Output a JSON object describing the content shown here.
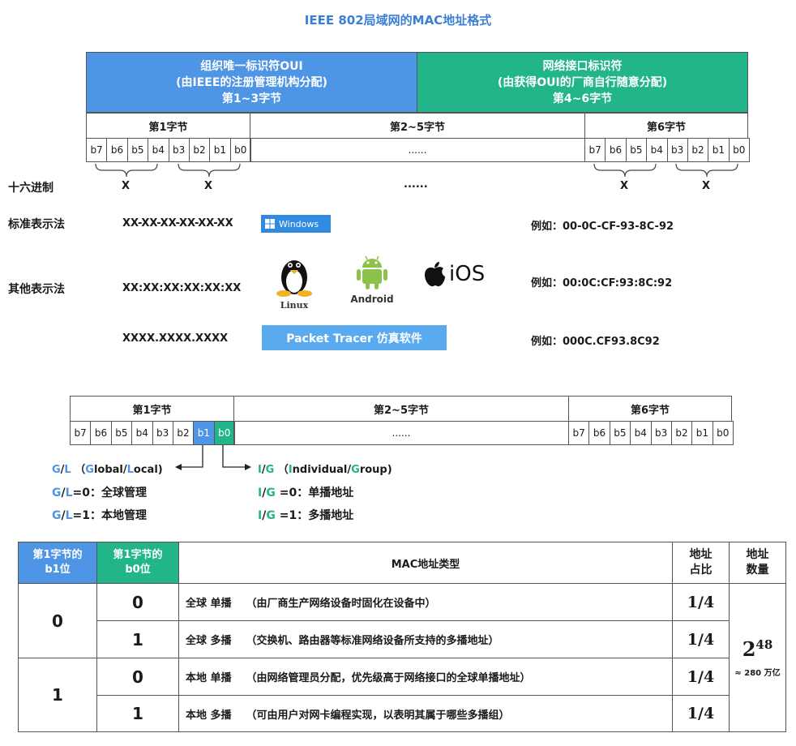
{
  "title": "IEEE 802局域网的MAC地址格式",
  "top_table": {
    "oui_lines": [
      "组织唯一标识符OUI",
      "(由IEEE的注册管理机构分配)",
      "第1~3字节"
    ],
    "nic_lines": [
      "网络接口标识符",
      "(由获得OUI的厂商自行随意分配)",
      "第4~6字节"
    ],
    "byte1": "第1字节",
    "byte25": "第2~5字节",
    "byte6": "第6字节",
    "bits": [
      "b7",
      "b6",
      "b5",
      "b4",
      "b3",
      "b2",
      "b1",
      "b0"
    ],
    "dots": "......",
    "x": "X"
  },
  "rows": {
    "hex_label": "十六进制",
    "std_label": "标准表示法",
    "std_format": "XX-XX-XX-XX-XX-XX",
    "std_example": "例如：00-0C-CF-93-8C-92",
    "windows": "Windows",
    "other_label": "其他表示法",
    "colon_format": "XX:XX:XX:XX:XX:XX",
    "colon_example": "例如：00:0C:CF:93:8C:92",
    "linux": "Linux",
    "android": "Android",
    "ios": "iOS",
    "dot_format": "XXXX.XXXX.XXXX",
    "packet_tracer": "Packet Tracer 仿真软件",
    "dot_example": "例如：000C.CF93.8C92"
  },
  "bit_table": {
    "byte1": "第1字节",
    "byte25": "第2~5字节",
    "byte6": "第6字节",
    "bits": [
      "b7",
      "b6",
      "b5",
      "b4",
      "b3",
      "b2",
      "b1",
      "b0"
    ],
    "dots": "......"
  },
  "gl_ig": {
    "gl_head_a": "G",
    "gl_head_b": "/",
    "gl_head_c": "L",
    "gl_head_paren": "（",
    "gl_g": "G",
    "gl_global": "lobal/",
    "gl_l": "L",
    "gl_local": "ocal)",
    "gl0_rest": "=0：全球管理",
    "gl1_rest": "=1：本地管理",
    "ig_head_a": "I",
    "ig_head_b": "/",
    "ig_head_c": "G",
    "ig_paren": "（",
    "ig_i": "I",
    "ig_individual": "ndividual/",
    "ig_g": "G",
    "ig_group": "roup)",
    "ig0_rest": " =0：单播地址",
    "ig1_rest": " =1：多播地址"
  },
  "type_table": {
    "h_b1": [
      "第1字节的",
      "b1位"
    ],
    "h_b0": [
      "第1字节的",
      "b0位"
    ],
    "h_type": "MAC地址类型",
    "h_ratio": [
      "地址",
      "占比"
    ],
    "h_count": [
      "地址",
      "数量"
    ],
    "rows": [
      {
        "b1": "0",
        "b0": "0",
        "type": "全球 单播",
        "desc": "（由厂商生产网络设备时固化在设备中）",
        "ratio": "1/4"
      },
      {
        "b1": "",
        "b0": "1",
        "type": "全球 多播",
        "desc": "（交换机、路由器等标准网络设备所支持的多播地址）",
        "ratio": "1/4"
      },
      {
        "b1": "1",
        "b0": "0",
        "type": "本地 单播",
        "desc": "（由网络管理员分配，优先级高于网络接口的全球单播地址）",
        "ratio": "1/4"
      },
      {
        "b1": "",
        "b0": "1",
        "type": "本地 多播",
        "desc": "（可由用户对网卡编程实现，以表明其属于哪些多播组）",
        "ratio": "1/4"
      }
    ],
    "count_base": "2",
    "count_exp": "48",
    "count_note": "≈ 280 万亿"
  },
  "colors": {
    "blue": "#4f95e6",
    "green": "#22b58a"
  }
}
